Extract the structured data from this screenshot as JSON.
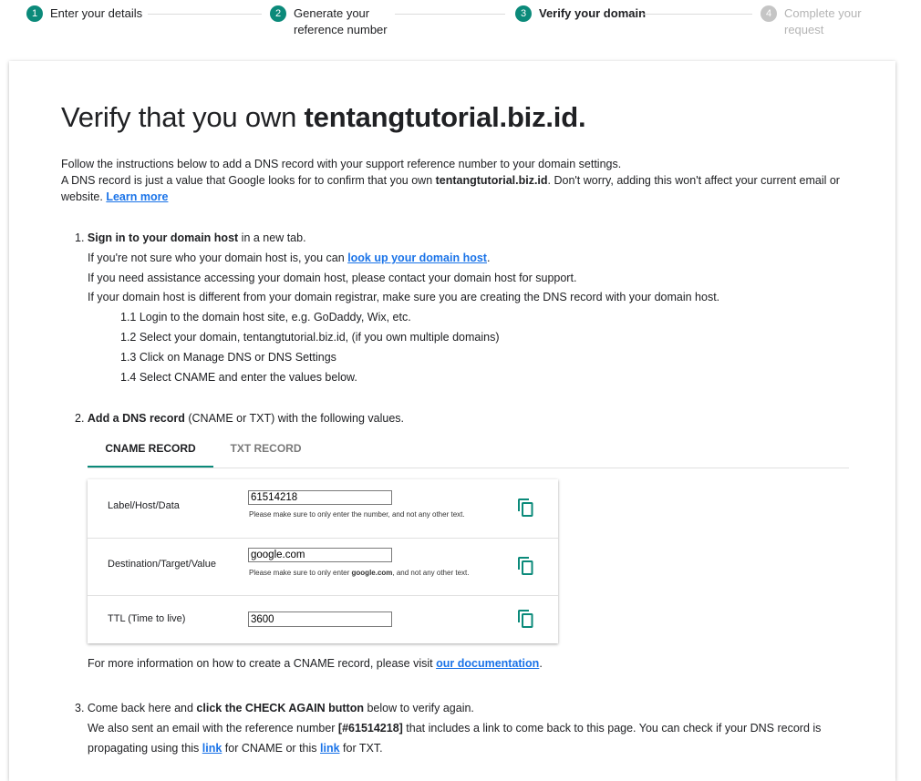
{
  "stepper": [
    {
      "num": "1",
      "label": "Enter your details",
      "state": "done"
    },
    {
      "num": "2",
      "label": "Generate your reference number",
      "state": "done"
    },
    {
      "num": "3",
      "label": "Verify your domain",
      "state": "active"
    },
    {
      "num": "4",
      "label": "Complete your request",
      "state": "inactive"
    }
  ],
  "page": {
    "title_prefix": "Verify that you own ",
    "title_domain": "tentangtutorial.biz.id.",
    "intro_line1": "Follow the instructions below to add a DNS record with your support reference number to your domain settings.",
    "intro_line2_a": "A DNS record is just a value that Google looks for to confirm that you own ",
    "intro_domain": "tentangtutorial.biz.id",
    "intro_line2_b": ". Don't worry, adding this won't affect your current email or website. ",
    "learn_more": "Learn more"
  },
  "step1": {
    "prefix": "1. ",
    "bold": "Sign in to your domain host",
    "rest": " in a new tab.",
    "line2_a": "If you're not sure who your domain host is, you can ",
    "line2_link": "look up your domain host",
    "line2_b": ".",
    "line3": "If you need assistance accessing your domain host, please contact your domain host for support.",
    "line4": "If your domain host is different from your domain registrar, make sure you are creating the DNS record with your domain host.",
    "sub1": "1.1 Login to the domain host site, e.g. GoDaddy, Wix, etc.",
    "sub2": "1.2 Select your domain, tentangtutorial.biz.id, (if you own multiple domains)",
    "sub3": "1.3 Click on Manage DNS or DNS Settings",
    "sub4": "1.4 Select CNAME and enter the values below."
  },
  "step2": {
    "prefix": "2. ",
    "bold": "Add a DNS record",
    "rest": " (CNAME or TXT) with the following values.",
    "tab_cname": "CNAME RECORD",
    "tab_txt": "TXT RECORD",
    "rows": [
      {
        "label": "Label/Host/Data",
        "value": "61514218",
        "hint_a": "Please make sure to only enter the number, and not any other text.",
        "hint_bold": "",
        "hint_b": ""
      },
      {
        "label": "Destination/Target/Value",
        "value": "google.com",
        "hint_a": "Please make sure to only enter ",
        "hint_bold": "google.com",
        "hint_b": ", and not any other text."
      },
      {
        "label": "TTL (Time to live)",
        "value": "3600"
      }
    ],
    "foot_a": "For more information on how to create a CNAME record, please visit ",
    "foot_link": "our documentation",
    "foot_b": "."
  },
  "step3": {
    "prefix": "3. ",
    "a": "Come back here and ",
    "bold": "click the CHECK AGAIN button",
    "b": " below to verify again.",
    "line2_a": "We also sent an email with the reference number ",
    "line2_ref": "[#61514218]",
    "line2_b": " that includes a link to come back to this page. You can check if your DNS record is",
    "line3_a": "propagating using this ",
    "link1": "link",
    "line3_b": " for CNAME or this ",
    "link2": "link",
    "line3_c": " for TXT."
  },
  "colors": {
    "accent": "#0b8a7a",
    "link": "#1a73e8",
    "inactive": "#b4b4b4"
  },
  "icons": {
    "copy": "copy-icon"
  }
}
